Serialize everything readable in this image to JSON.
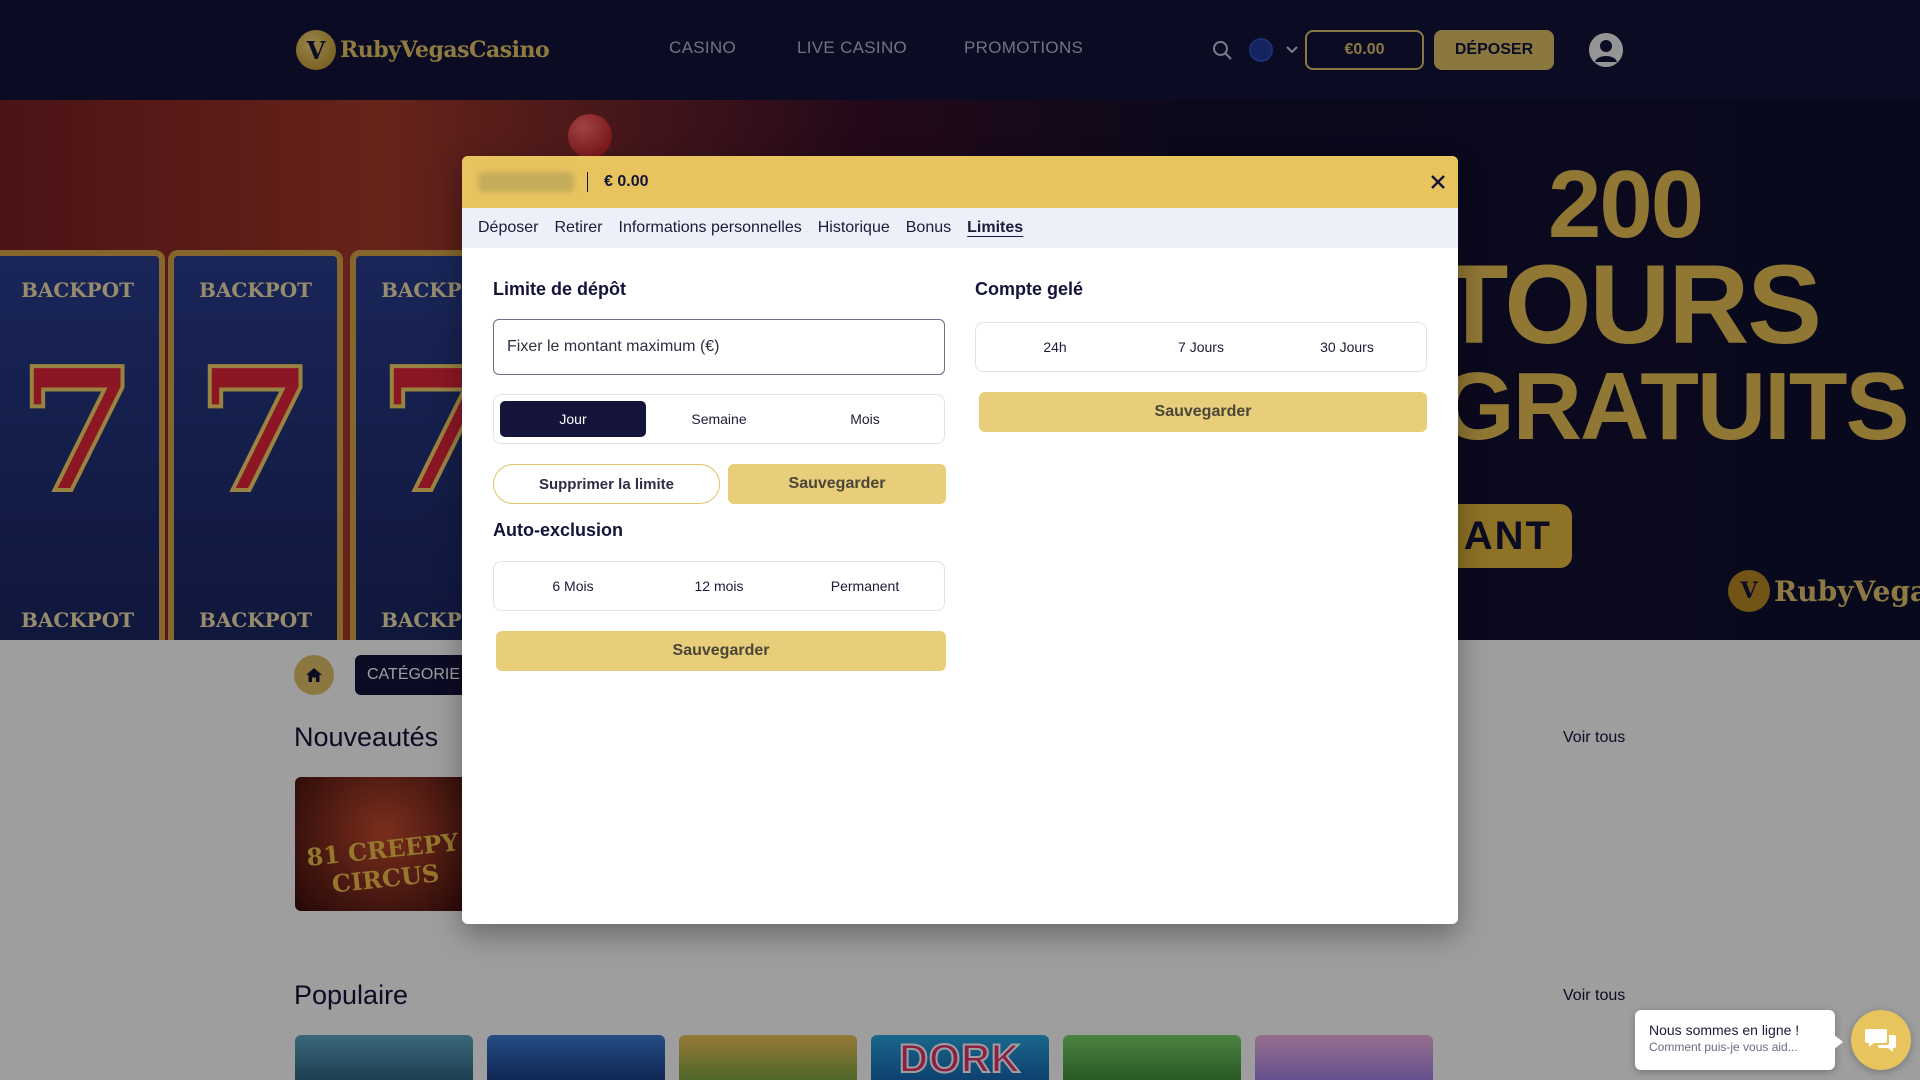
{
  "header": {
    "logo_mark": "V",
    "logo_text": "RubyVegasCasino",
    "nav": [
      "CASINO",
      "LIVE CASINO",
      "PROMOTIONS"
    ],
    "balance": "€0.00",
    "deposit_label": "DÉPOSER",
    "icons": {
      "search": "search-icon",
      "language": "eu-flag-icon",
      "chevron": "chevron-down-icon",
      "profile": "user-avatar-icon"
    }
  },
  "banner": {
    "reel_top": "BACKPOT",
    "reel_bottom": "BACKPOT",
    "reel_symbol": "7",
    "promo_line1": "200",
    "promo_line2": "TOURS",
    "promo_line3": "GRATUITS",
    "cta_fragment": "ANT",
    "brand_mark": "V",
    "brand": "RubyVegas"
  },
  "lobby": {
    "category_label": "CATÉGORIE",
    "sections": [
      {
        "title": "Nouveautés",
        "see_all": "Voir tous"
      },
      {
        "title": "Populaire",
        "see_all": "Voir tous"
      }
    ],
    "new_game_label": "81 CREEPY CIRCUS",
    "popular_game_label": "DORK"
  },
  "modal": {
    "balance": "€ 0.00",
    "tabs": [
      {
        "label": "Déposer",
        "active": false
      },
      {
        "label": "Retirer",
        "active": false
      },
      {
        "label": "Informations personnelles",
        "active": false
      },
      {
        "label": "Historique",
        "active": false
      },
      {
        "label": "Bonus",
        "active": false
      },
      {
        "label": "Limites",
        "active": true
      }
    ],
    "deposit_limit": {
      "title": "Limite de dépôt",
      "placeholder": "Fixer le montant maximum (€)",
      "value": "",
      "periods": [
        "Jour",
        "Semaine",
        "Mois"
      ],
      "selected_period": "Jour",
      "remove_label": "Supprimer la limite",
      "save_label": "Sauvegarder"
    },
    "self_exclusion": {
      "title": "Auto-exclusion",
      "options": [
        "6 Mois",
        "12 mois",
        "Permanent"
      ],
      "save_label": "Sauvegarder"
    },
    "account_freeze": {
      "title": "Compte gelé",
      "options": [
        "24h",
        "7 Jours",
        "30 Jours"
      ],
      "save_label": "Sauvegarder"
    }
  },
  "chat": {
    "title": "Nous sommes en ligne !",
    "subtitle": "Comment puis-je vous aid..."
  },
  "colors": {
    "header_bg": "#14133a",
    "accent_gold": "#e0c26a",
    "modal_header": "#e8c45e",
    "tab_bar": "#eef0f9",
    "active_segment": "#14133a"
  }
}
